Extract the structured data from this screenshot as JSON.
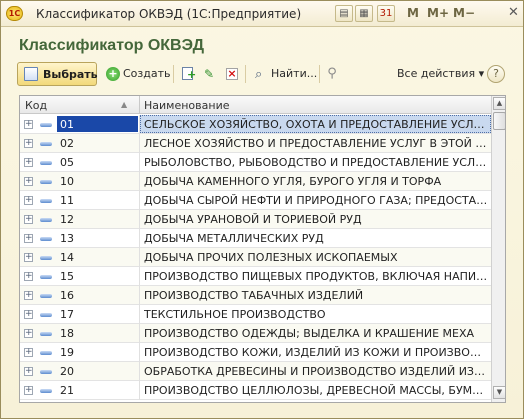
{
  "window": {
    "app_logo": "1C",
    "title": "Классификатор ОКВЭД  (1С:Предприятие)",
    "toolbar": {
      "m_label": "M",
      "m_plus_label": "M+",
      "m_minus_label": "M−",
      "close_glyph": "✕"
    }
  },
  "form": {
    "title": "Классификатор ОКВЭД"
  },
  "command_bar": {
    "select_label": "Выбрать",
    "create_label": "Создать",
    "find_label": "Найти...",
    "all_actions_label": "Все действия ▾",
    "help_label": "?"
  },
  "table": {
    "columns": {
      "code": "Код",
      "name": "Наименование"
    },
    "rows": [
      {
        "code": "01",
        "name": "СЕЛЬСКОЕ ХОЗЯЙСТВО, ОХОТА И ПРЕДОСТАВЛЕНИЕ УСЛУГ ...",
        "selected": true
      },
      {
        "code": "02",
        "name": "ЛЕСНОЕ ХОЗЯЙСТВО И ПРЕДОСТАВЛЕНИЕ УСЛУГ В ЭТОЙ О..."
      },
      {
        "code": "05",
        "name": "РЫБОЛОВСТВО, РЫБОВОДСТВО И ПРЕДОСТАВЛЕНИЕ УСЛУ..."
      },
      {
        "code": "10",
        "name": "ДОБЫЧА КАМЕННОГО УГЛЯ, БУРОГО УГЛЯ И ТОРФА"
      },
      {
        "code": "11",
        "name": "ДОБЫЧА СЫРОЙ НЕФТИ И ПРИРОДНОГО ГАЗА; ПРЕДОСТАВ..."
      },
      {
        "code": "12",
        "name": "ДОБЫЧА УРАНОВОЙ И ТОРИЕВОЙ РУД"
      },
      {
        "code": "13",
        "name": "ДОБЫЧА МЕТАЛЛИЧЕСКИХ РУД"
      },
      {
        "code": "14",
        "name": "ДОБЫЧА ПРОЧИХ ПОЛЕЗНЫХ ИСКОПАЕМЫХ"
      },
      {
        "code": "15",
        "name": "ПРОИЗВОДСТВО ПИЩЕВЫХ ПРОДУКТОВ, ВКЛЮЧАЯ НАПИТКИ"
      },
      {
        "code": "16",
        "name": "ПРОИЗВОДСТВО ТАБАЧНЫХ ИЗДЕЛИЙ"
      },
      {
        "code": "17",
        "name": "ТЕКСТИЛЬНОЕ ПРОИЗВОДСТВО"
      },
      {
        "code": "18",
        "name": "ПРОИЗВОДСТВО ОДЕЖДЫ; ВЫДЕЛКА И КРАШЕНИЕ МЕХА"
      },
      {
        "code": "19",
        "name": "ПРОИЗВОДСТВО КОЖИ, ИЗДЕЛИЙ ИЗ КОЖИ И ПРОИЗВОДС..."
      },
      {
        "code": "20",
        "name": "ОБРАБОТКА ДРЕВЕСИНЫ И ПРОИЗВОДСТВО ИЗДЕЛИЙ ИЗ Д..."
      },
      {
        "code": "21",
        "name": "ПРОИЗВОДСТВО ЦЕЛЛЮЛОЗЫ, ДРЕВЕСНОЙ МАССЫ, БУМАГ..."
      }
    ]
  },
  "colors": {
    "accent": "#44673a",
    "selection": "#1a48a8",
    "selection_row": "#c9d9ef"
  }
}
